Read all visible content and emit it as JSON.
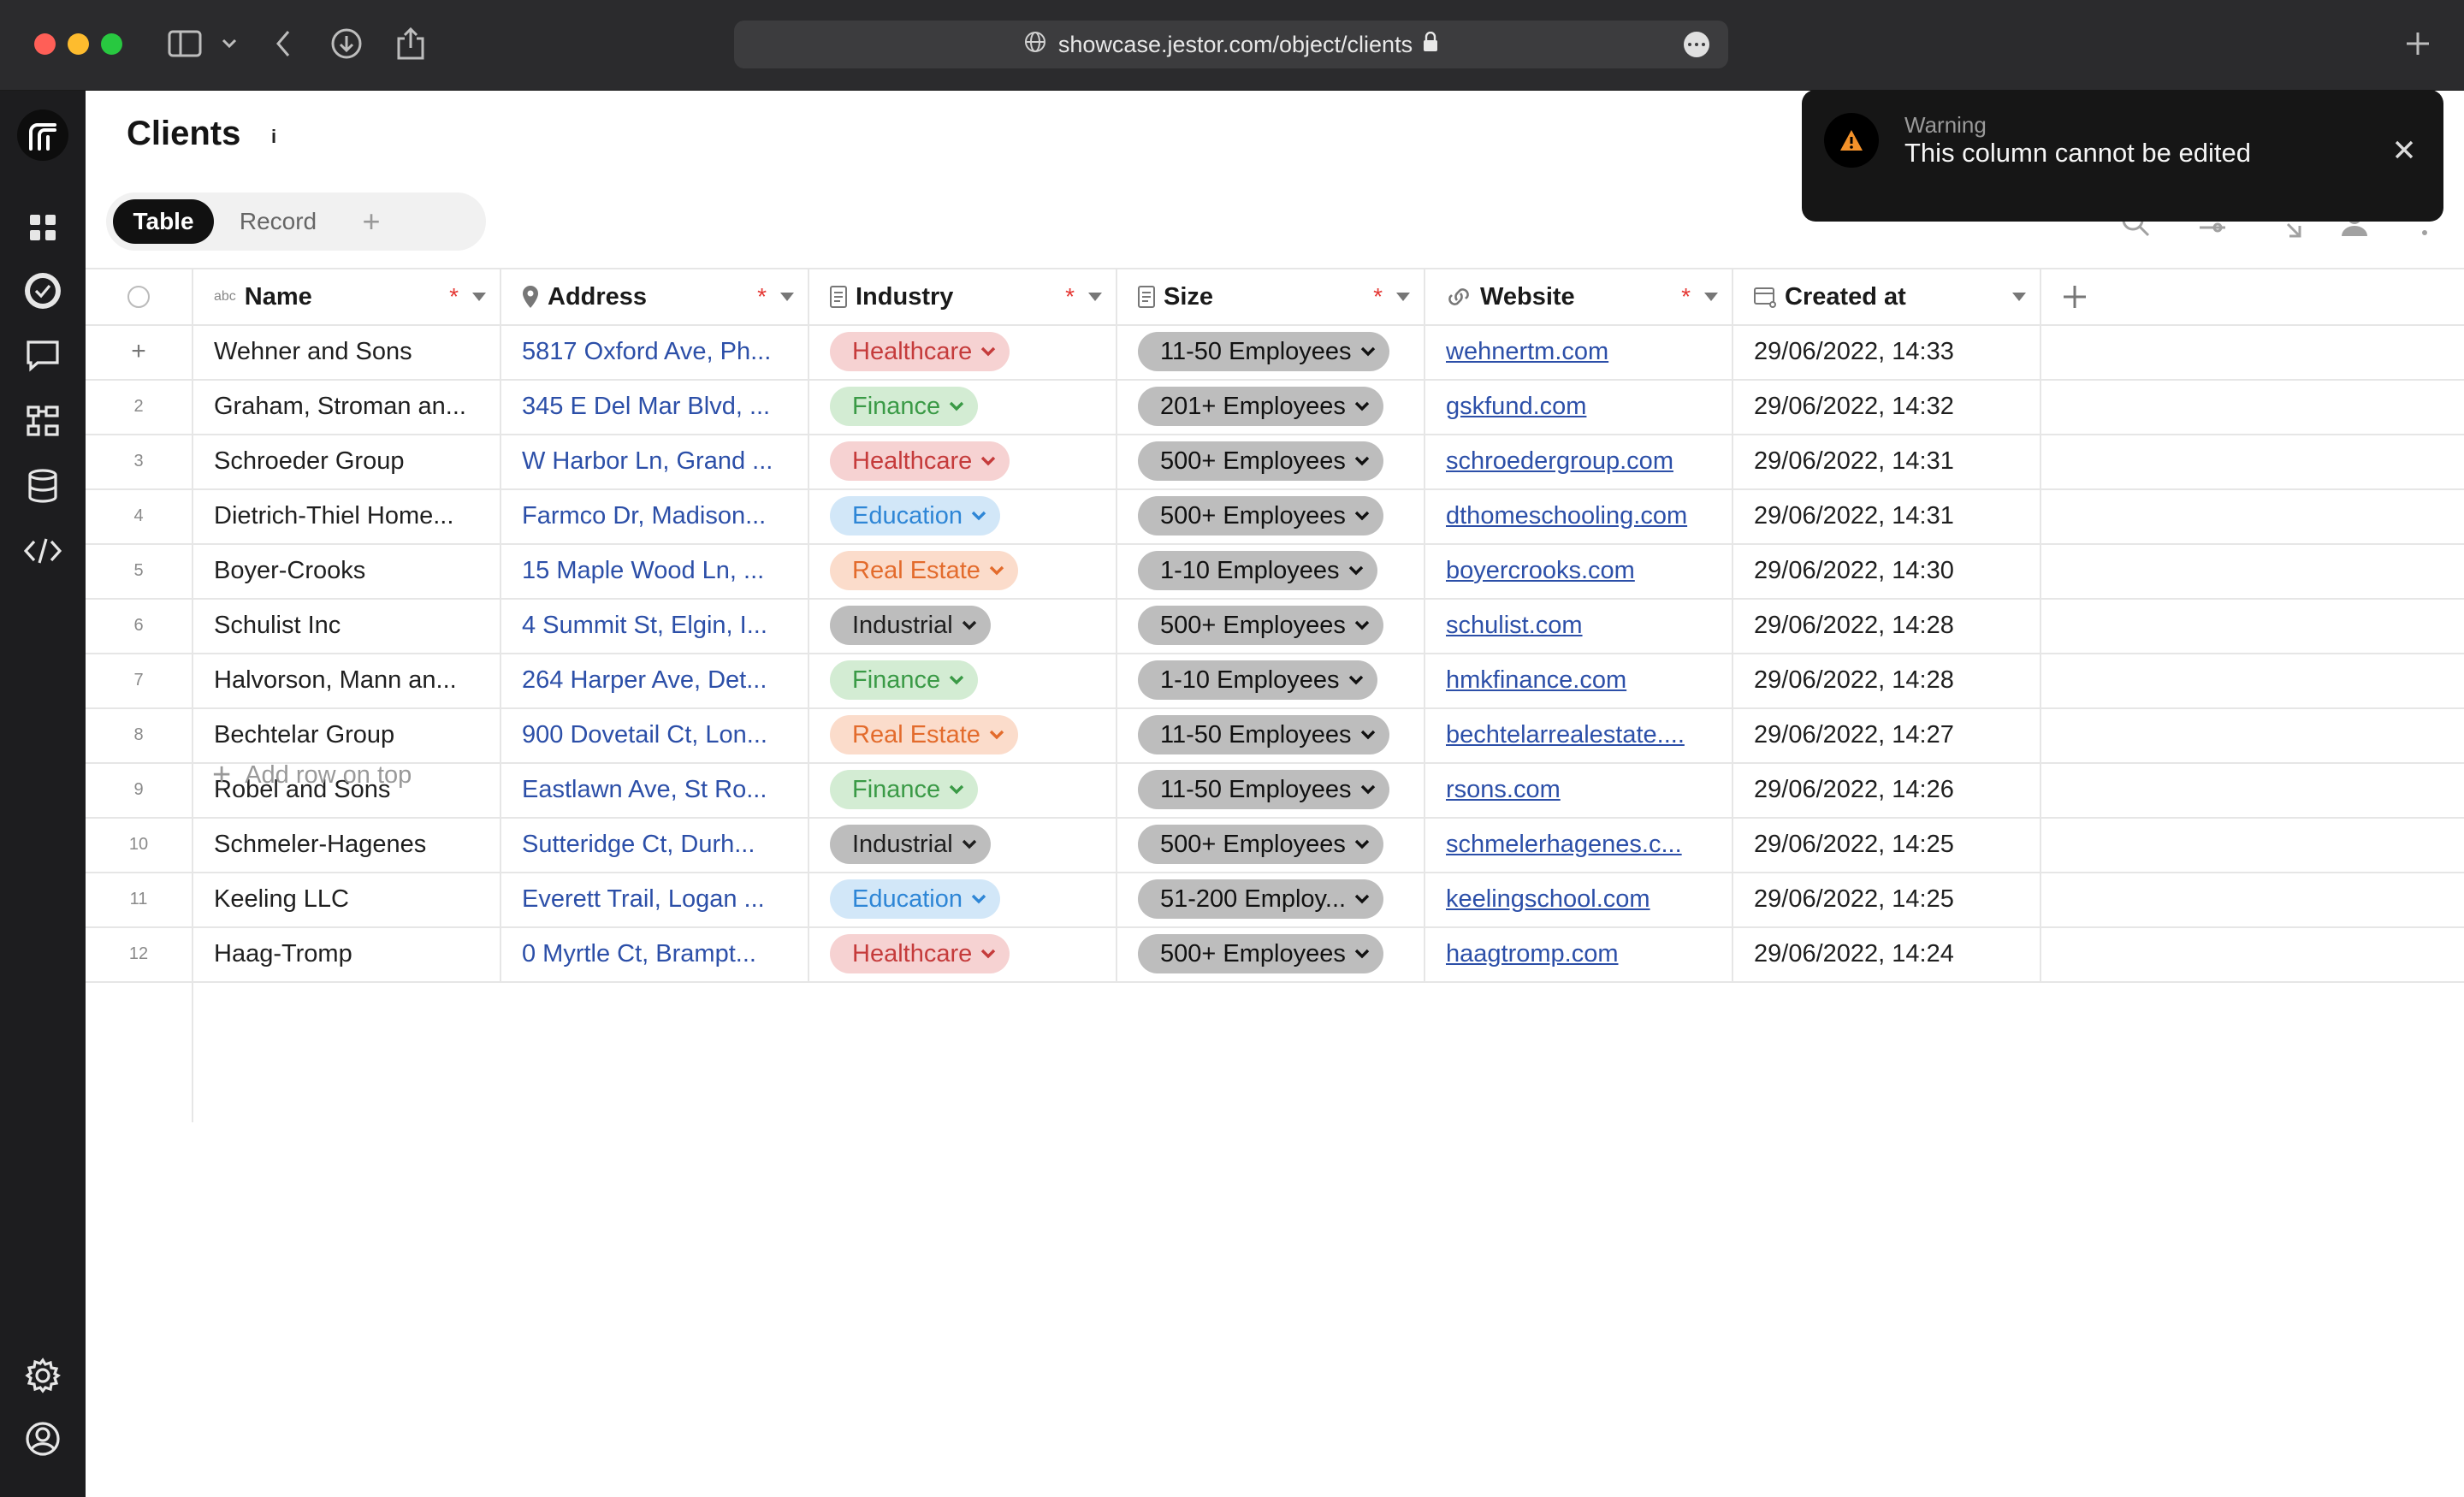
{
  "browser": {
    "url": "showcase.jestor.com/object/clients"
  },
  "page": {
    "title": "Clients",
    "info_symbol": "i",
    "views": [
      "Table",
      "Record"
    ],
    "add_view_symbol": "+"
  },
  "columns": {
    "name": "Name",
    "name_type": "abc",
    "address": "Address",
    "industry": "Industry",
    "size": "Size",
    "website": "Website",
    "created_at": "Created at",
    "required_mark": "*"
  },
  "colors": {
    "Healthcare": {
      "bg": "#f6d2d2",
      "fg": "#c53b3b"
    },
    "Finance": {
      "bg": "#d3ecd3",
      "fg": "#3a9a46"
    },
    "Education": {
      "bg": "#d2e7f8",
      "fg": "#2e86d6"
    },
    "Real Estate": {
      "bg": "#fbdccb",
      "fg": "#e36b2c"
    },
    "Industrial": {
      "bg": "#bdbdbd",
      "fg": "#1f1f1f"
    },
    "size": {
      "bg": "#bdbdbd",
      "fg": "#111111"
    }
  },
  "rows": [
    {
      "num": "+",
      "name": "Wehner and Sons",
      "address": "5817 Oxford Ave, Ph...",
      "industry": "Healthcare",
      "size": "11-50 Employees",
      "website": "wehnertm.com",
      "created_at": "29/06/2022, 14:33"
    },
    {
      "num": "2",
      "name": "Graham, Stroman an...",
      "address": "345 E Del Mar Blvd, ...",
      "industry": "Finance",
      "size": "201+ Employees",
      "website": "gskfund.com",
      "created_at": "29/06/2022, 14:32"
    },
    {
      "num": "3",
      "name": "Schroeder Group",
      "address": "W Harbor Ln, Grand ...",
      "industry": "Healthcare",
      "size": "500+ Employees",
      "website": "schroedergroup.com",
      "created_at": "29/06/2022, 14:31"
    },
    {
      "num": "4",
      "name": "Dietrich-Thiel Home...",
      "address": "Farmco Dr, Madison...",
      "industry": "Education",
      "size": "500+ Employees",
      "website": "dthomeschooling.com",
      "created_at": "29/06/2022, 14:31"
    },
    {
      "num": "5",
      "name": "Boyer-Crooks",
      "address": "15 Maple Wood Ln, ...",
      "industry": "Real Estate",
      "size": "1-10 Employees",
      "website": "boyercrooks.com",
      "created_at": "29/06/2022, 14:30"
    },
    {
      "num": "6",
      "name": "Schulist Inc",
      "address": "4 Summit St, Elgin, I...",
      "industry": "Industrial",
      "size": "500+ Employees",
      "website": "schulist.com",
      "created_at": "29/06/2022, 14:28"
    },
    {
      "num": "7",
      "name": "Halvorson, Mann an...",
      "address": "264 Harper Ave, Det...",
      "industry": "Finance",
      "size": "1-10 Employees",
      "website": "hmkfinance.com",
      "created_at": "29/06/2022, 14:28"
    },
    {
      "num": "8",
      "name": "Bechtelar Group",
      "address": "900 Dovetail Ct, Lon...",
      "industry": "Real Estate",
      "size": "11-50 Employees",
      "website": "bechtelarrealestate....",
      "created_at": "29/06/2022, 14:27"
    },
    {
      "num": "9",
      "name": "Robel and Sons",
      "address": "Eastlawn Ave, St Ro...",
      "industry": "Finance",
      "size": "11-50 Employees",
      "website": "rsons.com",
      "created_at": "29/06/2022, 14:26"
    },
    {
      "num": "10",
      "name": "Schmeler-Hagenes",
      "address": "Sutteridge Ct, Durh...",
      "industry": "Industrial",
      "size": "500+ Employees",
      "website": "schmelerhagenes.c...",
      "created_at": "29/06/2022, 14:25"
    },
    {
      "num": "11",
      "name": "Keeling LLC",
      "address": "Everett Trail, Logan ...",
      "industry": "Education",
      "size": "51-200 Employ...",
      "website": "keelingschool.com",
      "created_at": "29/06/2022, 14:25"
    },
    {
      "num": "12",
      "name": "Haag-Tromp",
      "address": "0 Myrtle Ct, Brampt...",
      "industry": "Healthcare",
      "size": "500+ Employees",
      "website": "haagtromp.com",
      "created_at": "29/06/2022, 14:24"
    }
  ],
  "add_row_label": "Add row on top",
  "toast": {
    "title": "Warning",
    "message": "This column cannot be edited"
  }
}
